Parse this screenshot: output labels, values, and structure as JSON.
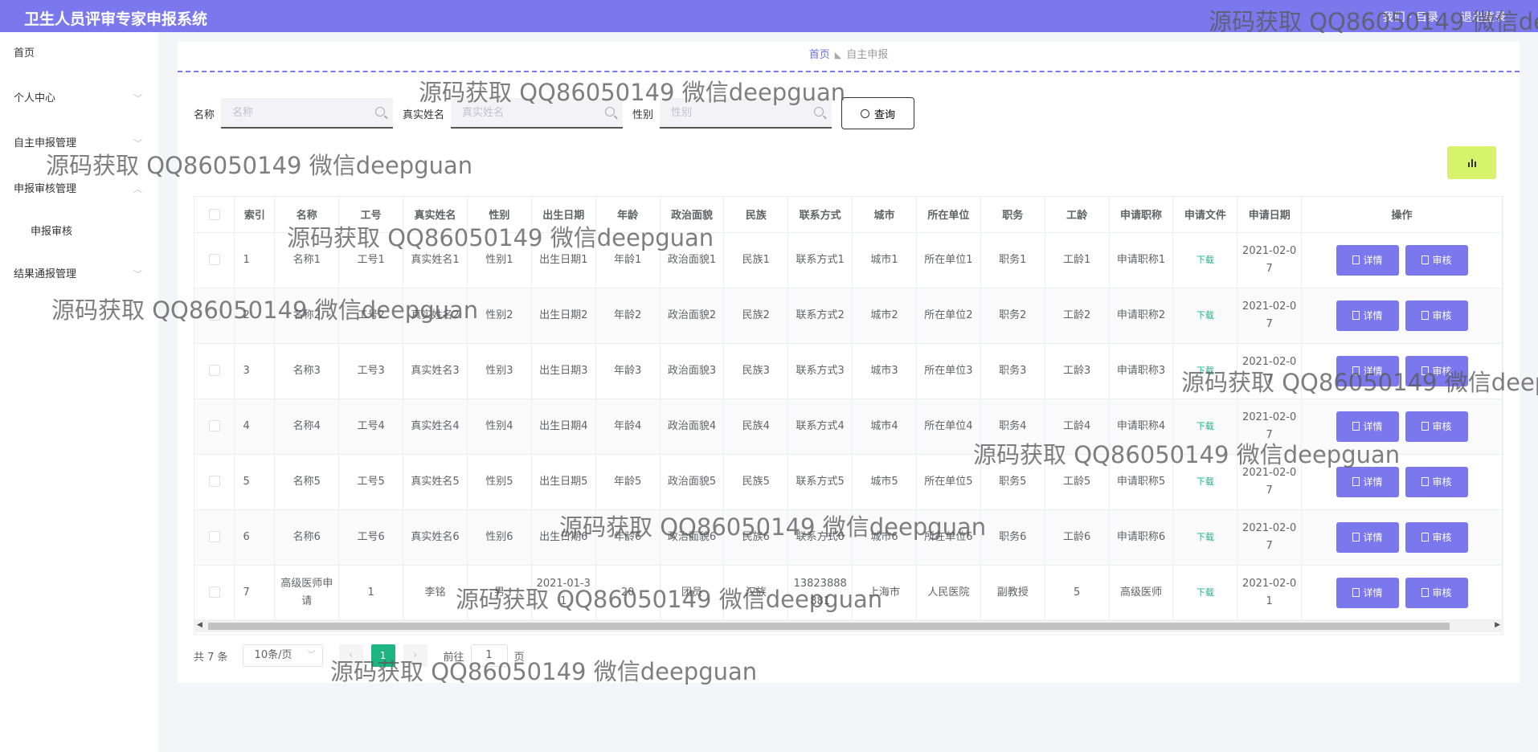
{
  "app": {
    "title": "卫生人员评审专家申报系统",
    "top_links": [
      "我们 · 目录",
      "退出登录"
    ]
  },
  "sidebar": {
    "items": [
      {
        "label": "首页"
      },
      {
        "label": "个人中心"
      },
      {
        "label": "自主申报管理"
      },
      {
        "label": "申报审核管理"
      },
      {
        "label": "申报审核"
      },
      {
        "label": "结果通报管理"
      }
    ]
  },
  "breadcrumb": {
    "home": "首页",
    "current": "自主申报"
  },
  "search": {
    "name_label": "名称",
    "name_placeholder": "名称",
    "realname_label": "真实姓名",
    "realname_placeholder": "真实姓名",
    "gender_label": "性别",
    "gender_placeholder": "性别",
    "query_label": "查询"
  },
  "table": {
    "headers": [
      "索引",
      "名称",
      "工号",
      "真实姓名",
      "性别",
      "出生日期",
      "年龄",
      "政治面貌",
      "民族",
      "联系方式",
      "城市",
      "所在单位",
      "职务",
      "工龄",
      "申请职称",
      "申请文件",
      "申请日期",
      "操作"
    ],
    "rows": [
      [
        "1",
        "名称1",
        "工号1",
        "真实姓名1",
        "性别1",
        "出生日期1",
        "年龄1",
        "政治面貌1",
        "民族1",
        "联系方式1",
        "城市1",
        "所在单位1",
        "职务1",
        "工龄1",
        "申请职称1",
        "下载",
        "2021-02-07"
      ],
      [
        "2",
        "名称2",
        "工号2",
        "真实姓名2",
        "性别2",
        "出生日期2",
        "年龄2",
        "政治面貌2",
        "民族2",
        "联系方式2",
        "城市2",
        "所在单位2",
        "职务2",
        "工龄2",
        "申请职称2",
        "下载",
        "2021-02-07"
      ],
      [
        "3",
        "名称3",
        "工号3",
        "真实姓名3",
        "性别3",
        "出生日期3",
        "年龄3",
        "政治面貌3",
        "民族3",
        "联系方式3",
        "城市3",
        "所在单位3",
        "职务3",
        "工龄3",
        "申请职称3",
        "下载",
        "2021-02-07"
      ],
      [
        "4",
        "名称4",
        "工号4",
        "真实姓名4",
        "性别4",
        "出生日期4",
        "年龄4",
        "政治面貌4",
        "民族4",
        "联系方式4",
        "城市4",
        "所在单位4",
        "职务4",
        "工龄4",
        "申请职称4",
        "下载",
        "2021-02-07"
      ],
      [
        "5",
        "名称5",
        "工号5",
        "真实姓名5",
        "性别5",
        "出生日期5",
        "年龄5",
        "政治面貌5",
        "民族5",
        "联系方式5",
        "城市5",
        "所在单位5",
        "职务5",
        "工龄5",
        "申请职称5",
        "下载",
        "2021-02-07"
      ],
      [
        "6",
        "名称6",
        "工号6",
        "真实姓名6",
        "性别6",
        "出生日期6",
        "年龄6",
        "政治面貌6",
        "民族6",
        "联系方式6",
        "城市6",
        "所在单位6",
        "职务6",
        "工龄6",
        "申请职称6",
        "下载",
        "2021-02-07"
      ],
      [
        "7",
        "高级医师申请",
        "1",
        "李铭",
        "男",
        "2021-01-31",
        "20",
        "团员",
        "汉族",
        "13823888881",
        "上海市",
        "人民医院",
        "副教授",
        "5",
        "高级医师",
        "下载",
        "2021-02-01"
      ]
    ],
    "detail_label": "详情",
    "review_label": "审核"
  },
  "pagination": {
    "total": "共 7 条",
    "page_size": "10条/页",
    "current_page": "1",
    "goto_prefix": "前往",
    "goto_value": "1",
    "goto_suffix": "页"
  },
  "watermark": "源码获取 QQ86050149 微信deepguan",
  "colors": {
    "primary": "#7b78ee",
    "success": "#1db683",
    "chart_button": "#d7f26b"
  }
}
